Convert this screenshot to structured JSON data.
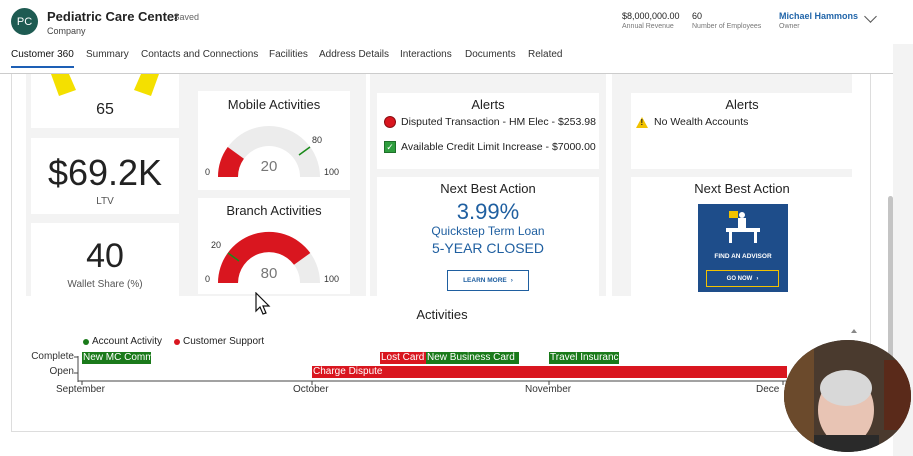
{
  "header": {
    "initials": "PC",
    "title": "Pediatric Care Center",
    "saved": "- Saved",
    "type": "Company",
    "annual_revenue_value": "$8,000,000.00",
    "annual_revenue_label": "Annual Revenue",
    "employees_value": "60",
    "employees_label": "Number of Employees",
    "owner_value": "Michael Hammons",
    "owner_label": "Owner"
  },
  "tabs": [
    "Customer 360",
    "Summary",
    "Contacts and Connections",
    "Facilities",
    "Address Details",
    "Interactions",
    "Documents",
    "Related"
  ],
  "dashboard": {
    "gauge_top_value": "65",
    "ltv_value": "$69.2K",
    "ltv_label": "LTV",
    "wallet_value": "40",
    "wallet_label": "Wallet Share (%)",
    "mobile": {
      "title": "Mobile Activities",
      "value": "20",
      "min": "0",
      "max": "100",
      "target": "80"
    },
    "branch": {
      "title": "Branch Activities",
      "value": "80",
      "min": "0",
      "max": "100",
      "target": "20"
    },
    "alerts_left": {
      "title": "Alerts",
      "items": [
        "Disputed Transaction - HM Elec - $253.98",
        "Available Credit Limit Increase - $7000.00"
      ]
    },
    "alerts_right": {
      "title": "Alerts",
      "items": [
        "No Wealth Accounts"
      ]
    },
    "nba_left": {
      "title": "Next Best Action",
      "rate": "3.99%",
      "line1": "Quickstep Term Loan",
      "line2": "5-YEAR CLOSED",
      "button": "LEARN MORE"
    },
    "nba_right": {
      "title": "Next Best Action",
      "ad_text": "FIND AN ADVISOR",
      "ad_button": "GO NOW"
    },
    "activities": {
      "title": "Activities",
      "legend": [
        "Account Activity",
        "Customer Support"
      ],
      "rows": [
        "Complete",
        "Open"
      ],
      "x_labels": [
        "September",
        "October",
        "November",
        "Dece"
      ],
      "bars_complete": [
        "New MC Comm",
        "Lost Card",
        "New Business Card",
        "Travel Insuranc"
      ],
      "bars_open": [
        "Charge Dispute"
      ]
    }
  },
  "colors": {
    "accent": "#1d5fb5",
    "gauge_red": "#d9161f",
    "account_activity": "#1a7a1a",
    "customer_support": "#d9161f",
    "advisor_blue": "#1e4d8a"
  }
}
